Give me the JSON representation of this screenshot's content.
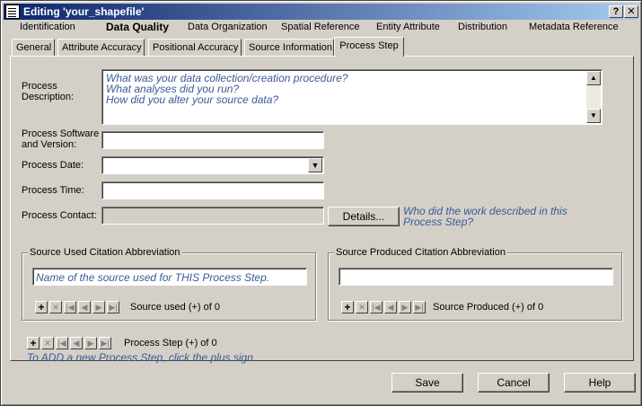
{
  "window": {
    "title": "Editing 'your_shapefile'",
    "help_glyph": "?",
    "close_glyph": "✕"
  },
  "main_tabs": [
    {
      "label": "Identification"
    },
    {
      "label": "Data Quality"
    },
    {
      "label": "Data Organization"
    },
    {
      "label": "Spatial Reference"
    },
    {
      "label": "Entity Attribute"
    },
    {
      "label": "Distribution"
    },
    {
      "label": "Metadata Reference"
    }
  ],
  "sub_tabs": [
    {
      "label": "General"
    },
    {
      "label": "Attribute Accuracy"
    },
    {
      "label": "Positional Accuracy"
    },
    {
      "label": "Source Information"
    },
    {
      "label": "Process Step"
    }
  ],
  "form": {
    "process_description": {
      "label": "Process Description:",
      "placeholder_lines": [
        "What was your data collection/creation procedure?",
        "What analyses did you run?",
        "How did you alter your source data?"
      ]
    },
    "software": {
      "label": "Process Software and Version:",
      "value": ""
    },
    "date": {
      "label": "Process Date:",
      "value": ""
    },
    "time": {
      "label": "Process Time:",
      "value": ""
    },
    "contact": {
      "label": "Process Contact:",
      "details_button": "Details...",
      "hint": "Who did the work described in this Process Step?"
    }
  },
  "source_used": {
    "title": "Source Used Citation Abbreviation",
    "placeholder": "Name of the source used for THIS Process Step.",
    "nav_label": "Source used (+) of 0"
  },
  "source_produced": {
    "title": "Source Produced Citation Abbreviation",
    "value": "",
    "nav_label": "Source Produced (+) of 0"
  },
  "process_step_nav": {
    "label": "Process Step (+) of 0",
    "hint": "To ADD a new Process Step, click the plus sign."
  },
  "nav_glyphs": {
    "add": "+",
    "delete": "✕",
    "first": "|◀",
    "prev": "◀",
    "next": "▶",
    "last": "▶|"
  },
  "scroll_glyphs": {
    "up": "▲",
    "down": "▼",
    "combo": "▼"
  },
  "buttons": {
    "save": "Save",
    "cancel": "Cancel",
    "help": "Help"
  },
  "colors": {
    "title_gradient_start": "#0a246a",
    "title_gradient_end": "#a6caf0",
    "hint_text": "#3a5a96",
    "face": "#d4d0c8"
  }
}
